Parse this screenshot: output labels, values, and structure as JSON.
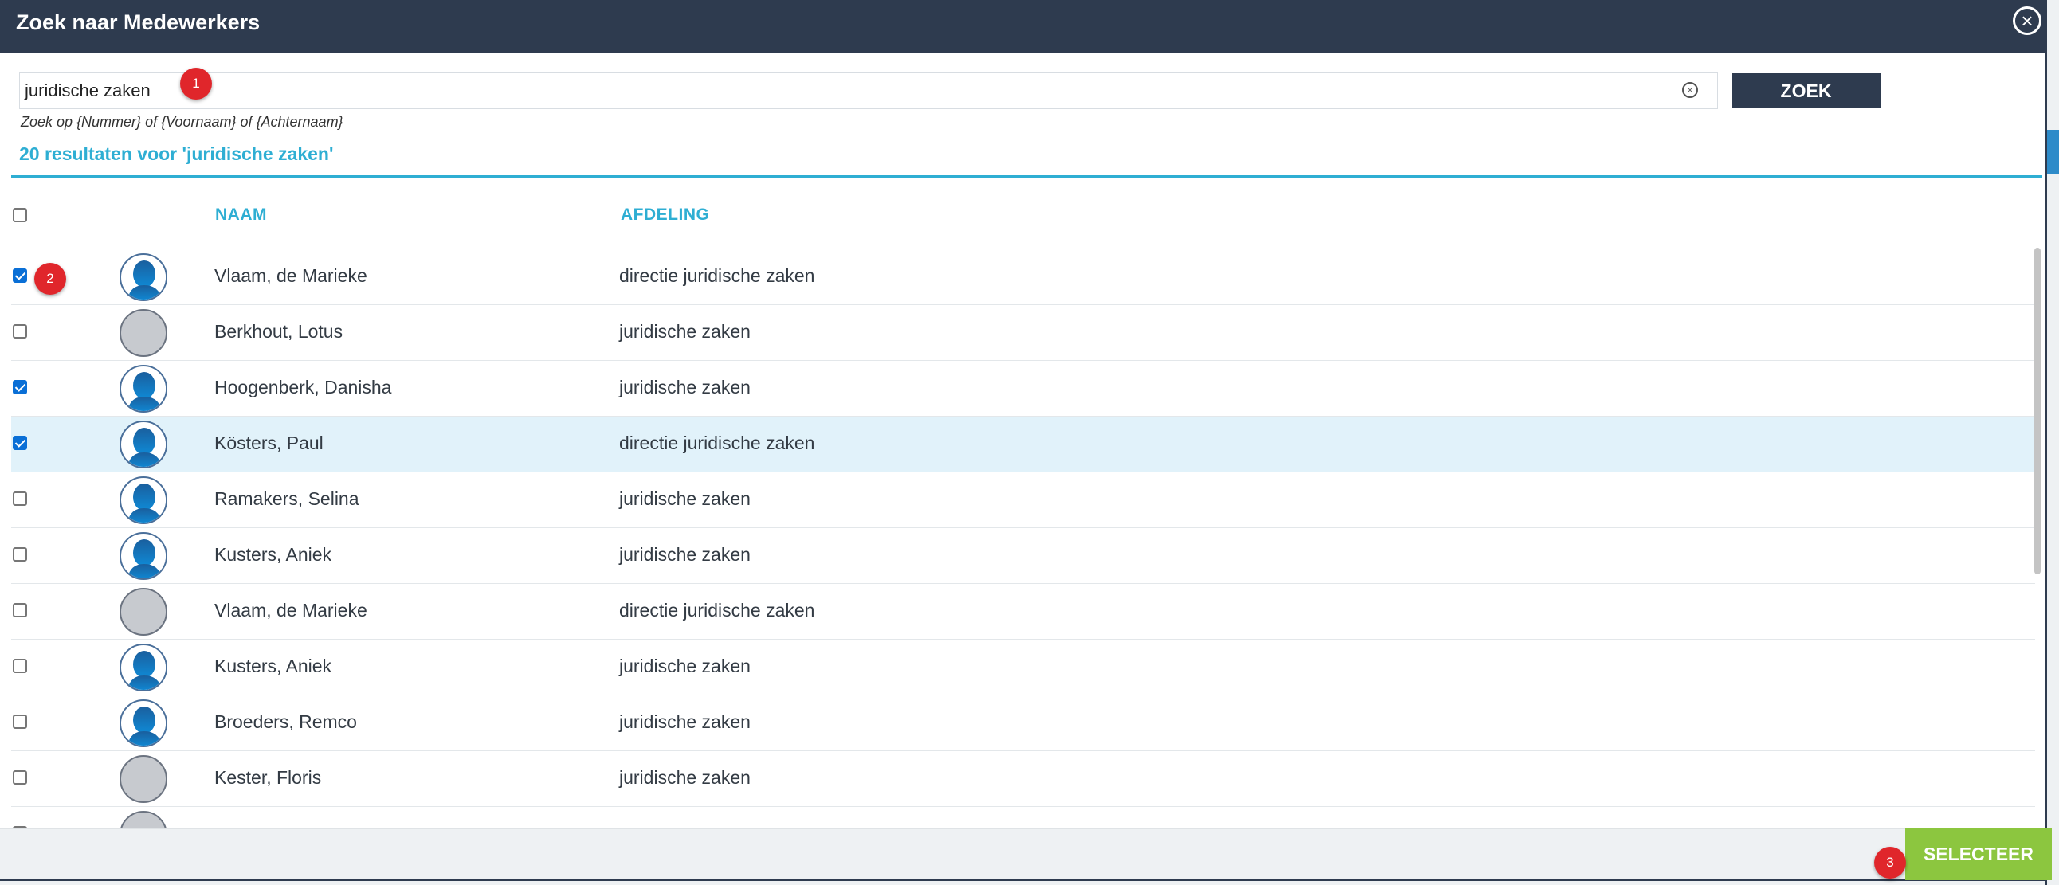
{
  "dialog": {
    "title": "Zoek naar Medewerkers",
    "close_icon": "close-icon"
  },
  "search": {
    "value": "juridische zaken",
    "button_label": "ZOEK",
    "hint": "Zoek op {Nummer} of {Voornaam} of {Achternaam}",
    "results_text": "20 resultaten voor 'juridische zaken'"
  },
  "table": {
    "headers": {
      "name": "NAAM",
      "department": "AFDELING"
    },
    "select_all_checked": false,
    "rows": [
      {
        "name": "Vlaam, de Marieke",
        "department": "directie juridische zaken",
        "checked": true,
        "photo": true,
        "highlighted": false
      },
      {
        "name": "Berkhout, Lotus",
        "department": "juridische zaken",
        "checked": false,
        "photo": false,
        "highlighted": false
      },
      {
        "name": "Hoogenberk, Danisha",
        "department": "juridische zaken",
        "checked": true,
        "photo": true,
        "highlighted": false
      },
      {
        "name": "Kösters, Paul",
        "department": "directie juridische zaken",
        "checked": true,
        "photo": true,
        "highlighted": true
      },
      {
        "name": "Ramakers, Selina",
        "department": "juridische zaken",
        "checked": false,
        "photo": true,
        "highlighted": false
      },
      {
        "name": "Kusters, Aniek",
        "department": "juridische zaken",
        "checked": false,
        "photo": true,
        "highlighted": false
      },
      {
        "name": "Vlaam, de Marieke",
        "department": "directie juridische zaken",
        "checked": false,
        "photo": false,
        "highlighted": false
      },
      {
        "name": "Kusters, Aniek",
        "department": "juridische zaken",
        "checked": false,
        "photo": true,
        "highlighted": false
      },
      {
        "name": "Broeders, Remco",
        "department": "juridische zaken",
        "checked": false,
        "photo": true,
        "highlighted": false
      },
      {
        "name": "Kester, Floris",
        "department": "juridische zaken",
        "checked": false,
        "photo": false,
        "highlighted": false
      },
      {
        "name": "",
        "department": "",
        "checked": false,
        "photo": false,
        "highlighted": false
      }
    ]
  },
  "footer": {
    "select_label": "SELECTEER"
  },
  "markers": [
    "1",
    "2",
    "3"
  ],
  "colors": {
    "header_bg": "#2e3b4f",
    "accent": "#2eaed3",
    "select_button": "#8cc63f",
    "marker": "#e0262b",
    "highlight_row": "#e1f2fa"
  }
}
